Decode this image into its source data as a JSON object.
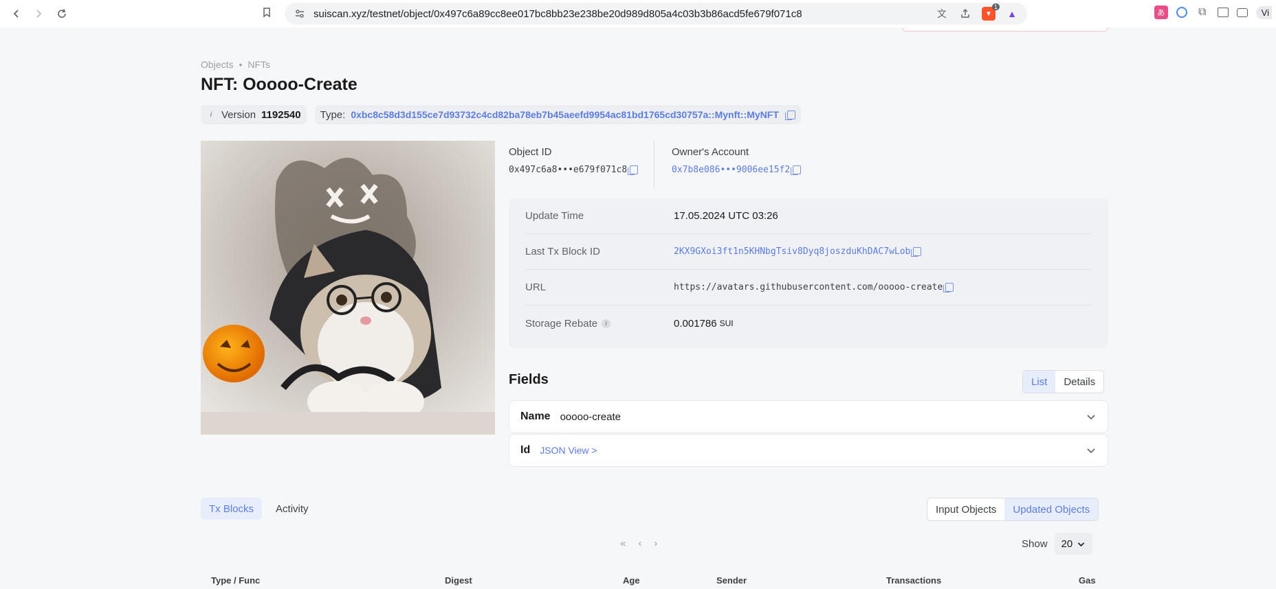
{
  "browser": {
    "url": "suiscan.xyz/testnet/object/0x497c6a89cc8ee017bc8bb23e238be20d989d805a4c03b3b86acd5fe679f071c8",
    "profile_label": "Vi",
    "extension_badge": "1"
  },
  "breadcrumb": [
    "Objects",
    "NFTs"
  ],
  "page_title": "NFT: Ooooo-Create",
  "version": {
    "label": "Version",
    "value": "1192540"
  },
  "type": {
    "label": "Type:",
    "value": "0xbc8c58d3d155ce7d93732c4cd82ba78eb7b45aeefd9954ac81bd1765cd30757a::Mynft::MyNFT"
  },
  "object_id": {
    "label": "Object ID",
    "value": "0x497c6a8•••e679f071c8"
  },
  "owner": {
    "label": "Owner's Account",
    "value": "0x7b8e086•••9006ee15f2"
  },
  "details": {
    "update_time": {
      "label": "Update Time",
      "value": "17.05.2024 UTC 03:26"
    },
    "last_tx": {
      "label": "Last Tx Block ID",
      "value": "2KX9GXoi3ft1n5KHNbgTsiv8Dyq8joszduKhDAC7wLob"
    },
    "url": {
      "label": "URL",
      "value": "https://avatars.githubusercontent.com/ooooo-create"
    },
    "storage_rebate": {
      "label": "Storage Rebate",
      "value": "0.001786",
      "unit": "SUI"
    }
  },
  "fields": {
    "title": "Fields",
    "view_list": "List",
    "view_details": "Details",
    "name": {
      "label": "Name",
      "value": "ooooo-create"
    },
    "id": {
      "label": "Id",
      "value": "JSON View >"
    }
  },
  "tabs": [
    "Tx Blocks",
    "Activity"
  ],
  "object_filter": [
    "Input Objects",
    "Updated Objects"
  ],
  "pager": {
    "first": "«",
    "prev": "‹",
    "next": "›"
  },
  "show": {
    "label": "Show",
    "value": "20"
  },
  "table_headers": [
    "Type / Func",
    "Digest",
    "Age",
    "Sender",
    "Transactions",
    "Gas"
  ],
  "colors": {
    "accent": "#5b7ce0",
    "active_bg": "#e8edfb",
    "card_bg": "#eff1f5"
  }
}
